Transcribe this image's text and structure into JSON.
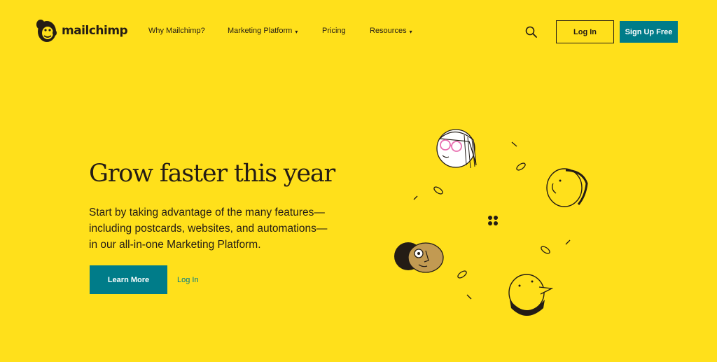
{
  "header": {
    "logo_text": "mailchimp",
    "nav": [
      {
        "label": "Why Mailchimp?",
        "has_dropdown": false
      },
      {
        "label": "Marketing Platform",
        "has_dropdown": true
      },
      {
        "label": "Pricing",
        "has_dropdown": false
      },
      {
        "label": "Resources",
        "has_dropdown": true
      }
    ],
    "search_icon": "search-icon",
    "login_label": "Log In",
    "signup_label": "Sign Up Free"
  },
  "hero": {
    "title": "Grow faster this year",
    "copy_lines": [
      "Start by taking advantage of the many features—",
      "including postcards, websites, and automations—",
      "in our all-in-one Marketing Platform."
    ],
    "learn_more_label": "Learn More",
    "login_link_label": "Log In"
  },
  "colors": {
    "background": "#FFE01B",
    "text": "#241C15",
    "accent_teal": "#007C89",
    "glasses_pink": "#E86FB0"
  }
}
